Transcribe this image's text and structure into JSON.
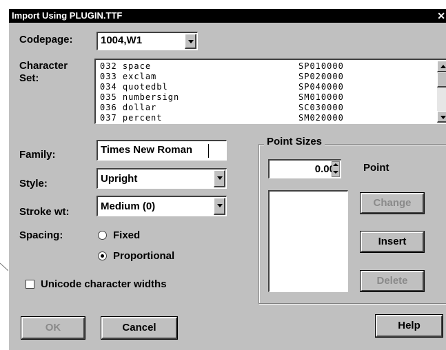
{
  "window": {
    "title": "Import Using PLUGIN.TTF",
    "close_glyph": "✕"
  },
  "codepage": {
    "label": "Codepage:",
    "value": "1004,W1"
  },
  "character_set": {
    "label_line1": "Character",
    "label_line2": "Set:",
    "rows": [
      {
        "code": "032",
        "name": "space",
        "id": "SP010000"
      },
      {
        "code": "033",
        "name": "exclam",
        "id": "SP020000"
      },
      {
        "code": "034",
        "name": "quotedbl",
        "id": "SP040000"
      },
      {
        "code": "035",
        "name": "numbersign",
        "id": "SM010000"
      },
      {
        "code": "036",
        "name": "dollar",
        "id": "SC030000"
      },
      {
        "code": "037",
        "name": "percent",
        "id": "SM020000"
      }
    ]
  },
  "family": {
    "label": "Family:",
    "value": "Times New Roman"
  },
  "style": {
    "label": "Style:",
    "value": "Upright"
  },
  "stroke_weight": {
    "label": "Stroke wt:",
    "value": "Medium (0)"
  },
  "spacing": {
    "label": "Spacing:",
    "options": [
      {
        "label": "Fixed",
        "selected": false
      },
      {
        "label": "Proportional",
        "selected": true
      }
    ]
  },
  "unicode_widths": {
    "label": "Unicode character widths",
    "checked": false
  },
  "point_sizes": {
    "title": "Point Sizes",
    "value": "0.00",
    "unit_label": "Point",
    "change_label": "Change",
    "insert_label": "Insert",
    "delete_label": "Delete"
  },
  "buttons": {
    "ok": "OK",
    "cancel": "Cancel",
    "help": "Help"
  },
  "colors": {
    "dialog_bg": "#c0c0c0",
    "title_bg": "#000000",
    "disabled_text": "#8a8a8a"
  }
}
